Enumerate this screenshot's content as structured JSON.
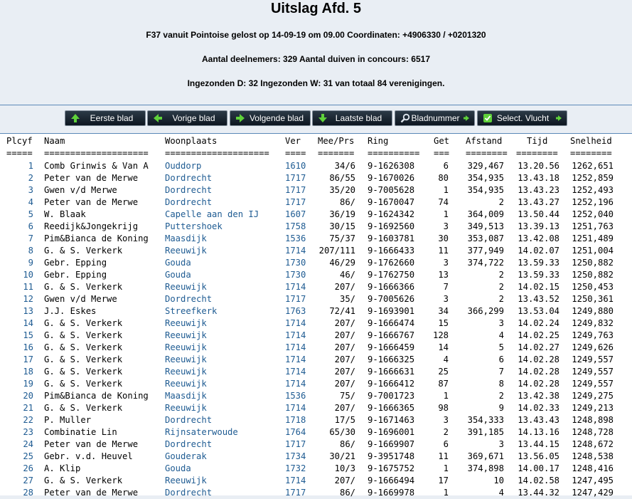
{
  "header": {
    "title": "Uitslag Afd. 5",
    "line1": "F37 vanuit Pointoise gelost op 14-09-19 om 09.00 Coordinaten: +4906330 / +0201320",
    "line2": "Aantal deelnemers: 329 Aantal duiven in concours: 6517",
    "line3": "Ingezonden D: 32 Ingezonden W: 31 van totaal 84 verenigingen."
  },
  "toolbar": {
    "first": "Eerste blad",
    "prev": "Vorige blad",
    "next": "Volgende blad",
    "last": "Laatste blad",
    "page_number": "Bladnummer",
    "select_flight": "Select. Vlucht"
  },
  "table": {
    "columns": {
      "plcyf": "Plcyf",
      "naam": "Naam",
      "woonplaats": "Woonplaats",
      "ver": "Ver",
      "meeprs": "Mee/Prs",
      "ring": "Ring",
      "get": "Get",
      "afstand": "Afstand",
      "tijd": "Tijd",
      "snelheid": "Snelheid"
    },
    "dashes": {
      "plcyf": "=====",
      "naam": "====================",
      "woonplaats": "====================",
      "ver": "====",
      "meeprs": "=======",
      "ring": "==========",
      "get": "===",
      "afstand": "========",
      "tijd": "========",
      "snelheid": "========"
    },
    "rows": [
      {
        "plc": "1",
        "naam": "Comb Grinwis & Van A",
        "woon": "Ouddorp",
        "ver": "1610",
        "mee": "34/6",
        "ring": "9-1626308",
        "get": "6",
        "afstand": "329,467",
        "tijd": "13.20.56",
        "snel": "1262,651"
      },
      {
        "plc": "2",
        "naam": "Peter van de Merwe",
        "woon": "Dordrecht",
        "ver": "1717",
        "mee": "86/55",
        "ring": "9-1670026",
        "get": "80",
        "afstand": "354,935",
        "tijd": "13.43.18",
        "snel": "1252,859"
      },
      {
        "plc": "3",
        "naam": "Gwen v/d Merwe",
        "woon": "Dordrecht",
        "ver": "1717",
        "mee": "35/20",
        "ring": "9-7005628",
        "get": "1",
        "afstand": "354,935",
        "tijd": "13.43.23",
        "snel": "1252,493"
      },
      {
        "plc": "4",
        "naam": "Peter van de Merwe",
        "woon": "Dordrecht",
        "ver": "1717",
        "mee": "86/",
        "ring": "9-1670047",
        "get": "74",
        "afstand": "2",
        "tijd": "13.43.27",
        "snel": "1252,196"
      },
      {
        "plc": "5",
        "naam": "W. Blaak",
        "woon": "Capelle aan den IJ",
        "ver": "1607",
        "mee": "36/19",
        "ring": "9-1624342",
        "get": "1",
        "afstand": "364,009",
        "tijd": "13.50.44",
        "snel": "1252,040"
      },
      {
        "plc": "6",
        "naam": "Reedijk&Jongekrijg",
        "woon": "Puttershoek",
        "ver": "1758",
        "mee": "30/15",
        "ring": "9-1692560",
        "get": "3",
        "afstand": "349,513",
        "tijd": "13.39.13",
        "snel": "1251,763"
      },
      {
        "plc": "7",
        "naam": "Pim&Bianca de Koning",
        "woon": "Maasdijk",
        "ver": "1536",
        "mee": "75/37",
        "ring": "9-1603781",
        "get": "30",
        "afstand": "353,087",
        "tijd": "13.42.08",
        "snel": "1251,489"
      },
      {
        "plc": "8",
        "naam": "G. & S. Verkerk",
        "woon": "Reeuwijk",
        "ver": "1714",
        "mee": "207/111",
        "ring": "9-1666433",
        "get": "11",
        "afstand": "377,949",
        "tijd": "14.02.07",
        "snel": "1251,004"
      },
      {
        "plc": "9",
        "naam": "Gebr. Epping",
        "woon": "Gouda",
        "ver": "1730",
        "mee": "46/29",
        "ring": "9-1762660",
        "get": "3",
        "afstand": "374,722",
        "tijd": "13.59.33",
        "snel": "1250,882"
      },
      {
        "plc": "10",
        "naam": "Gebr. Epping",
        "woon": "Gouda",
        "ver": "1730",
        "mee": "46/",
        "ring": "9-1762750",
        "get": "13",
        "afstand": "2",
        "tijd": "13.59.33",
        "snel": "1250,882"
      },
      {
        "plc": "11",
        "naam": "G. & S. Verkerk",
        "woon": "Reeuwijk",
        "ver": "1714",
        "mee": "207/",
        "ring": "9-1666366",
        "get": "7",
        "afstand": "2",
        "tijd": "14.02.15",
        "snel": "1250,453"
      },
      {
        "plc": "12",
        "naam": "Gwen v/d Merwe",
        "woon": "Dordrecht",
        "ver": "1717",
        "mee": "35/",
        "ring": "9-7005626",
        "get": "3",
        "afstand": "2",
        "tijd": "13.43.52",
        "snel": "1250,361"
      },
      {
        "plc": "13",
        "naam": "J.J. Eskes",
        "woon": "Streefkerk",
        "ver": "1763",
        "mee": "72/41",
        "ring": "9-1693901",
        "get": "34",
        "afstand": "366,299",
        "tijd": "13.53.04",
        "snel": "1249,880"
      },
      {
        "plc": "14",
        "naam": "G. & S. Verkerk",
        "woon": "Reeuwijk",
        "ver": "1714",
        "mee": "207/",
        "ring": "9-1666474",
        "get": "15",
        "afstand": "3",
        "tijd": "14.02.24",
        "snel": "1249,832"
      },
      {
        "plc": "15",
        "naam": "G. & S. Verkerk",
        "woon": "Reeuwijk",
        "ver": "1714",
        "mee": "207/",
        "ring": "9-1666767",
        "get": "128",
        "afstand": "4",
        "tijd": "14.02.25",
        "snel": "1249,763"
      },
      {
        "plc": "16",
        "naam": "G. & S. Verkerk",
        "woon": "Reeuwijk",
        "ver": "1714",
        "mee": "207/",
        "ring": "9-1666459",
        "get": "14",
        "afstand": "5",
        "tijd": "14.02.27",
        "snel": "1249,626"
      },
      {
        "plc": "17",
        "naam": "G. & S. Verkerk",
        "woon": "Reeuwijk",
        "ver": "1714",
        "mee": "207/",
        "ring": "9-1666325",
        "get": "4",
        "afstand": "6",
        "tijd": "14.02.28",
        "snel": "1249,557"
      },
      {
        "plc": "18",
        "naam": "G. & S. Verkerk",
        "woon": "Reeuwijk",
        "ver": "1714",
        "mee": "207/",
        "ring": "9-1666631",
        "get": "25",
        "afstand": "7",
        "tijd": "14.02.28",
        "snel": "1249,557"
      },
      {
        "plc": "19",
        "naam": "G. & S. Verkerk",
        "woon": "Reeuwijk",
        "ver": "1714",
        "mee": "207/",
        "ring": "9-1666412",
        "get": "87",
        "afstand": "8",
        "tijd": "14.02.28",
        "snel": "1249,557"
      },
      {
        "plc": "20",
        "naam": "Pim&Bianca de Koning",
        "woon": "Maasdijk",
        "ver": "1536",
        "mee": "75/",
        "ring": "9-7001723",
        "get": "1",
        "afstand": "2",
        "tijd": "13.42.38",
        "snel": "1249,275"
      },
      {
        "plc": "21",
        "naam": "G. & S. Verkerk",
        "woon": "Reeuwijk",
        "ver": "1714",
        "mee": "207/",
        "ring": "9-1666365",
        "get": "98",
        "afstand": "9",
        "tijd": "14.02.33",
        "snel": "1249,213"
      },
      {
        "plc": "22",
        "naam": "P. Muller",
        "woon": "Dordrecht",
        "ver": "1718",
        "mee": "17/5",
        "ring": "9-1671463",
        "get": "3",
        "afstand": "354,333",
        "tijd": "13.43.43",
        "snel": "1248,898"
      },
      {
        "plc": "23",
        "naam": "Combinatie Lin",
        "woon": "Rijnsaterwoude",
        "ver": "1764",
        "mee": "65/30",
        "ring": "9-1696001",
        "get": "2",
        "afstand": "391,185",
        "tijd": "14.13.16",
        "snel": "1248,728"
      },
      {
        "plc": "24",
        "naam": "Peter van de Merwe",
        "woon": "Dordrecht",
        "ver": "1717",
        "mee": "86/",
        "ring": "9-1669907",
        "get": "6",
        "afstand": "3",
        "tijd": "13.44.15",
        "snel": "1248,672"
      },
      {
        "plc": "25",
        "naam": "Gebr. v.d. Heuvel",
        "woon": "Gouderak",
        "ver": "1734",
        "mee": "30/21",
        "ring": "9-3951748",
        "get": "11",
        "afstand": "369,671",
        "tijd": "13.56.05",
        "snel": "1248,538"
      },
      {
        "plc": "26",
        "naam": "A. Klip",
        "woon": "Gouda",
        "ver": "1732",
        "mee": "10/3",
        "ring": "9-1675752",
        "get": "1",
        "afstand": "374,898",
        "tijd": "14.00.17",
        "snel": "1248,416"
      },
      {
        "plc": "27",
        "naam": "G. & S. Verkerk",
        "woon": "Reeuwijk",
        "ver": "1714",
        "mee": "207/",
        "ring": "9-1666494",
        "get": "17",
        "afstand": "10",
        "tijd": "14.02.58",
        "snel": "1247,495"
      },
      {
        "plc": "28",
        "naam": "Peter van de Merwe",
        "woon": "Dordrecht",
        "ver": "1717",
        "mee": "86/",
        "ring": "9-1669978",
        "get": "1",
        "afstand": "4",
        "tijd": "13.44.32",
        "snel": "1247,429"
      }
    ]
  }
}
